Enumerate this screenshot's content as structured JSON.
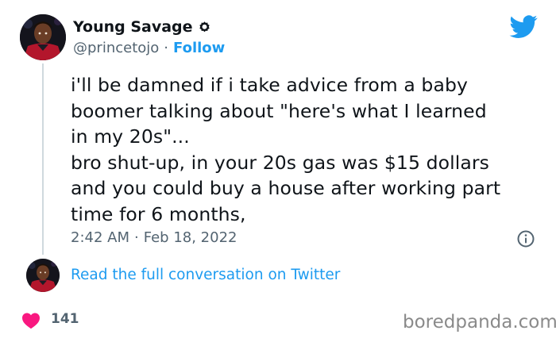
{
  "author": {
    "name": "Young Savage",
    "handle": "@princetojo",
    "separator": "·",
    "follow_label": "Follow"
  },
  "tweet": {
    "text": "i'll be damned if i take advice from a baby\nboomer talking about \"here's what I learned\nin my 20s\"...\nbro shut-up, in your 20s gas was $15 dollars\nand you could buy a house after working part\ntime for 6 months,",
    "time": "2:42 AM",
    "separator": "·",
    "date": "Feb 18, 2022"
  },
  "conversation": {
    "link_label": "Read the full conversation on Twitter"
  },
  "engagement": {
    "likes": "141"
  },
  "watermark": {
    "text": "boredpanda.com"
  },
  "icons": {
    "verified": "verified-badge-icon",
    "twitter": "twitter-bird-icon",
    "info": "info-icon",
    "like": "heart-icon"
  },
  "colors": {
    "accent": "#1d9bf0",
    "text": "#0f1419",
    "secondary": "#536471",
    "like": "#f91880",
    "thread_line": "#cfd9de",
    "watermark": "#8a8a8a"
  }
}
